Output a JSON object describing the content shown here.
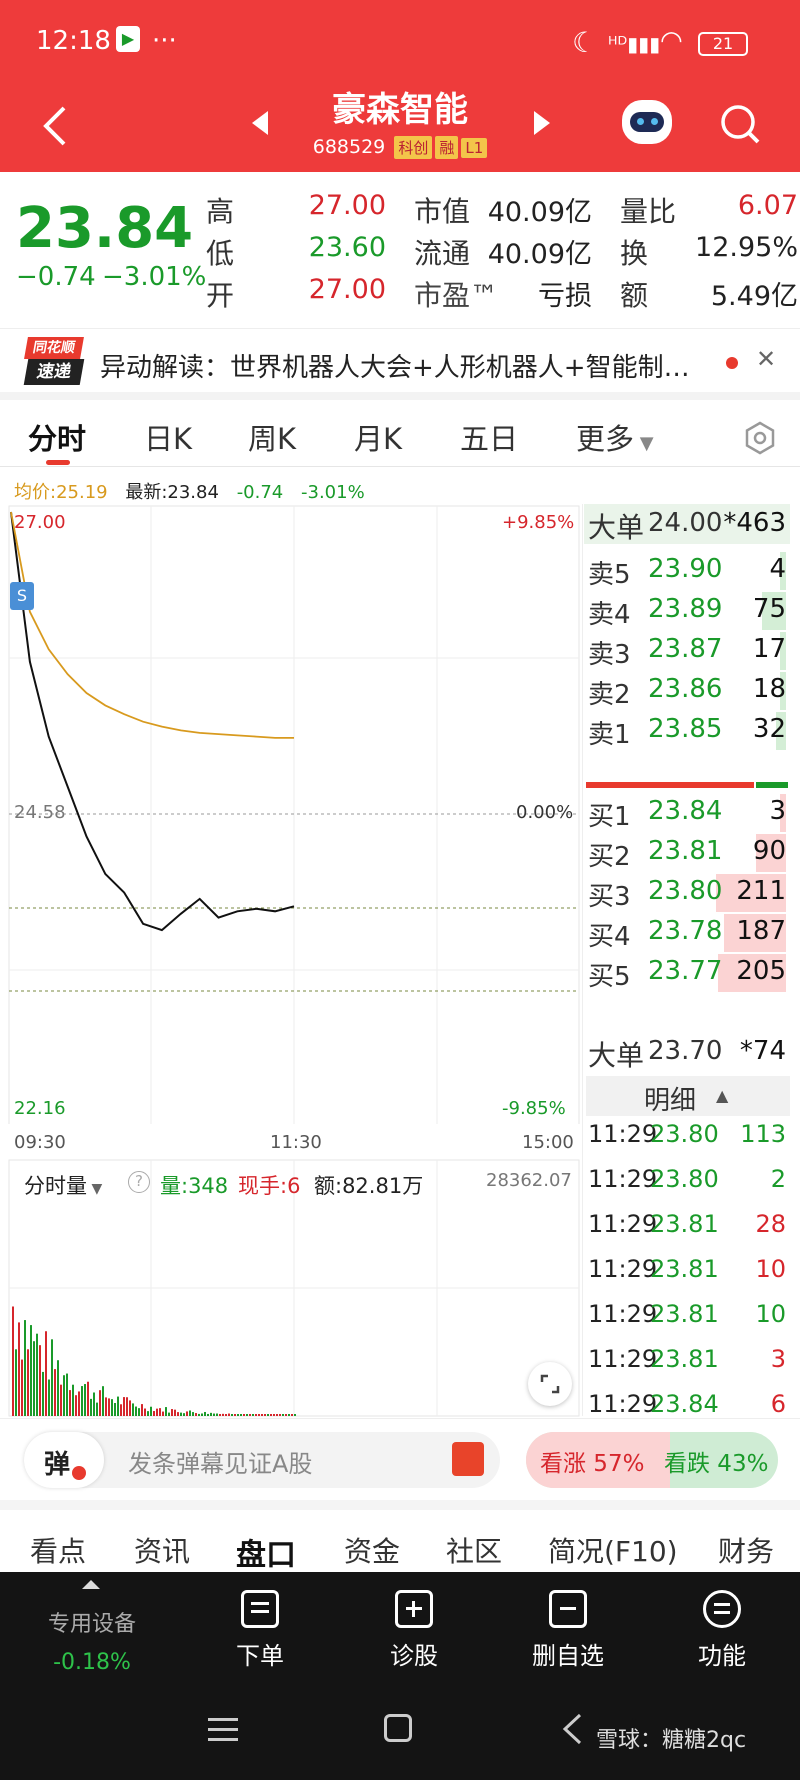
{
  "status_bar": {
    "time": "12:18",
    "dots": "···",
    "battery": "21"
  },
  "header": {
    "title": "豪森智能",
    "code": "688529",
    "tags": [
      "科创",
      "融",
      "L1"
    ]
  },
  "quote": {
    "price": "23.84",
    "change": "−0.74",
    "change_pct": "−3.01%",
    "rows": [
      {
        "l1": "高",
        "v1": "27.00",
        "l2": "市值",
        "v2": "40.09亿",
        "l3": "量比",
        "v3": "6.07"
      },
      {
        "l1": "低",
        "v1": "23.60",
        "l2": "流通",
        "v2": "40.09亿",
        "l3": "换",
        "v3": "12.95%"
      },
      {
        "l1": "开",
        "v1": "27.00",
        "l2": "市盈™",
        "v2": "亏损",
        "l3": "额",
        "v3": "5.49亿"
      }
    ]
  },
  "news": {
    "logo_top": "同花顺",
    "logo_bottom": "速递",
    "text": "异动解读：世界机器人大会+人形机器人+智能制…",
    "close": "✕"
  },
  "chart_tabs": [
    "分时",
    "日K",
    "周K",
    "月K",
    "五日",
    "更多"
  ],
  "info_bar": {
    "avg": "均价:25.19",
    "latest": "最新:23.84",
    "chg": "-0.74",
    "pct": "-3.01%"
  },
  "chart": {
    "high_price": "27.00",
    "low_price": "22.16",
    "ref_price": "24.58",
    "high_pct": "+9.85%",
    "low_pct": "-9.85%",
    "ref_pct": "0.00%",
    "s_marker": "S",
    "times": [
      "09:30",
      "11:30",
      "15:00"
    ]
  },
  "chart_data": {
    "type": "line",
    "x": [
      "09:30",
      "09:35",
      "09:40",
      "09:45",
      "09:50",
      "09:55",
      "10:00",
      "10:10",
      "10:20",
      "10:30",
      "10:40",
      "10:50",
      "11:00",
      "11:10",
      "11:20",
      "11:29"
    ],
    "series": [
      {
        "values": [
          27.0,
          25.8,
          25.2,
          24.8,
          24.4,
          24.1,
          23.95,
          23.7,
          23.65,
          23.78,
          23.9,
          23.75,
          23.8,
          23.82,
          23.8,
          23.84
        ]
      },
      {
        "values": [
          27.0,
          26.2,
          25.9,
          25.7,
          25.55,
          25.45,
          25.38,
          25.32,
          25.28,
          25.25,
          25.23,
          25.22,
          25.21,
          25.2,
          25.19,
          25.19
        ]
      }
    ],
    "ylim": [
      22.16,
      27.0
    ]
  },
  "volume": {
    "label": "分时量",
    "qty": "量:348",
    "hand": "现手:6",
    "amt": "额:82.81万",
    "max": "28362.07"
  },
  "order_book": {
    "big_sell": {
      "label": "大单",
      "price": "24.00",
      "vol": "*463"
    },
    "asks": [
      {
        "label": "卖5",
        "price": "23.90",
        "vol": "4",
        "bar": 0.02
      },
      {
        "label": "卖4",
        "price": "23.89",
        "vol": "75",
        "bar": 0.35
      },
      {
        "label": "卖3",
        "price": "23.87",
        "vol": "17",
        "bar": 0.08
      },
      {
        "label": "卖2",
        "price": "23.86",
        "vol": "18",
        "bar": 0.09
      },
      {
        "label": "卖1",
        "price": "23.85",
        "vol": "32",
        "bar": 0.15
      }
    ],
    "bids": [
      {
        "label": "买1",
        "price": "23.84",
        "vol": "3",
        "bar": 0.02
      },
      {
        "label": "买2",
        "price": "23.81",
        "vol": "90",
        "bar": 0.43
      },
      {
        "label": "买3",
        "price": "23.80",
        "vol": "211",
        "bar": 1.0
      },
      {
        "label": "买4",
        "price": "23.78",
        "vol": "187",
        "bar": 0.89
      },
      {
        "label": "买5",
        "price": "23.77",
        "vol": "205",
        "bar": 0.97
      }
    ],
    "big_buy": {
      "label": "大单",
      "price": "23.70",
      "vol": "*74"
    }
  },
  "ticks": {
    "header": "明细",
    "rows": [
      {
        "t": "11:29",
        "p": "23.80",
        "v": "113",
        "c": "green"
      },
      {
        "t": "11:29",
        "p": "23.80",
        "v": "2",
        "c": "green"
      },
      {
        "t": "11:29",
        "p": "23.81",
        "v": "28",
        "c": "red"
      },
      {
        "t": "11:29",
        "p": "23.81",
        "v": "10",
        "c": "red"
      },
      {
        "t": "11:29",
        "p": "23.81",
        "v": "10",
        "c": "green"
      },
      {
        "t": "11:29",
        "p": "23.81",
        "v": "3",
        "c": "red"
      },
      {
        "t": "11:29",
        "p": "23.84",
        "v": "6",
        "c": "red"
      }
    ]
  },
  "danmaku": {
    "icon": "弹",
    "placeholder": "发条弹幕见证A股",
    "up": "看涨 57%",
    "down": "看跌 43%",
    "up_frac": 0.57
  },
  "bottom_tabs": [
    "看点",
    "资讯",
    "盘口",
    "资金",
    "社区",
    "简况(F10)",
    "财务"
  ],
  "nav": {
    "device": "专用设备",
    "device_chg": "-0.18%",
    "items": [
      "下单",
      "诊股",
      "删自选",
      "功能"
    ]
  },
  "watermark": "雪球：糖糖2qc",
  "colors": {
    "header": "#ee3b3b",
    "up": "#d6262c",
    "down": "#1a9a2a",
    "avg_line": "#d89a1e"
  }
}
